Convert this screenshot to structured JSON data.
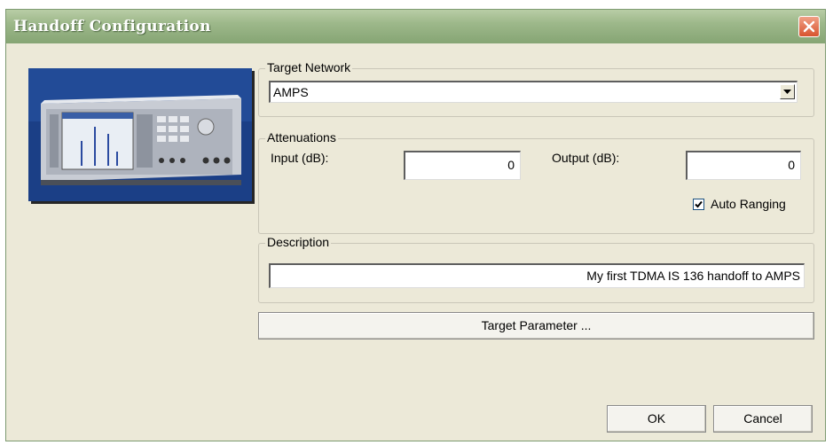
{
  "window": {
    "title": "Handoff Configuration"
  },
  "target_network": {
    "label": "Target Network",
    "selected": "AMPS"
  },
  "attenuations": {
    "label": "Attenuations",
    "input_label": "Input (dB):",
    "input_value": "0",
    "output_label": "Output (dB):",
    "output_value": "0",
    "auto_ranging_label": "Auto Ranging",
    "auto_ranging_checked": true
  },
  "description": {
    "label": "Description",
    "value": "My first TDMA IS 136 handoff to AMPS"
  },
  "buttons": {
    "target_parameter": "Target Parameter ...",
    "ok": "OK",
    "cancel": "Cancel"
  },
  "icons": {
    "close": "close-icon",
    "dropdown": "chevron-down-icon",
    "check": "check-icon"
  },
  "colors": {
    "titlebar": "#9db88a",
    "dialog_bg": "#ece9d8",
    "close_button": "#d8542f"
  }
}
